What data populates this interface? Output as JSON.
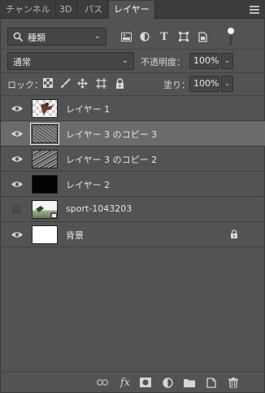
{
  "tabs": [
    {
      "label": "チャンネル",
      "active": false
    },
    {
      "label": "3D",
      "active": false
    },
    {
      "label": "パス",
      "active": false
    },
    {
      "label": "レイヤー",
      "active": true
    }
  ],
  "filter": {
    "kind_label": "種類"
  },
  "blend": {
    "mode": "通常",
    "opacity_label": "不透明度：",
    "opacity_value": "100%"
  },
  "lock": {
    "label": "ロック：",
    "fill_label": "塗り：",
    "fill_value": "100%"
  },
  "layers": [
    {
      "name": "レイヤー 1",
      "visible": true,
      "selected": false,
      "thumb": "checker-figure"
    },
    {
      "name": "レイヤー 3 のコピー 3",
      "visible": true,
      "selected": true,
      "thumb": "rock"
    },
    {
      "name": "レイヤー 3 のコピー 2",
      "visible": true,
      "selected": false,
      "thumb": "rock"
    },
    {
      "name": "レイヤー 2",
      "visible": true,
      "selected": false,
      "thumb": "black"
    },
    {
      "name": "sport-1043203",
      "visible": false,
      "selected": false,
      "thumb": "photo"
    },
    {
      "name": "背景",
      "visible": true,
      "selected": false,
      "locked": true,
      "thumb": "white"
    }
  ],
  "footer": {
    "fx_label": "fx"
  },
  "colors": {
    "panel_bg": "#535353",
    "tabbar_bg": "#3c3c3c",
    "selected_row": "#6b6b6b"
  }
}
